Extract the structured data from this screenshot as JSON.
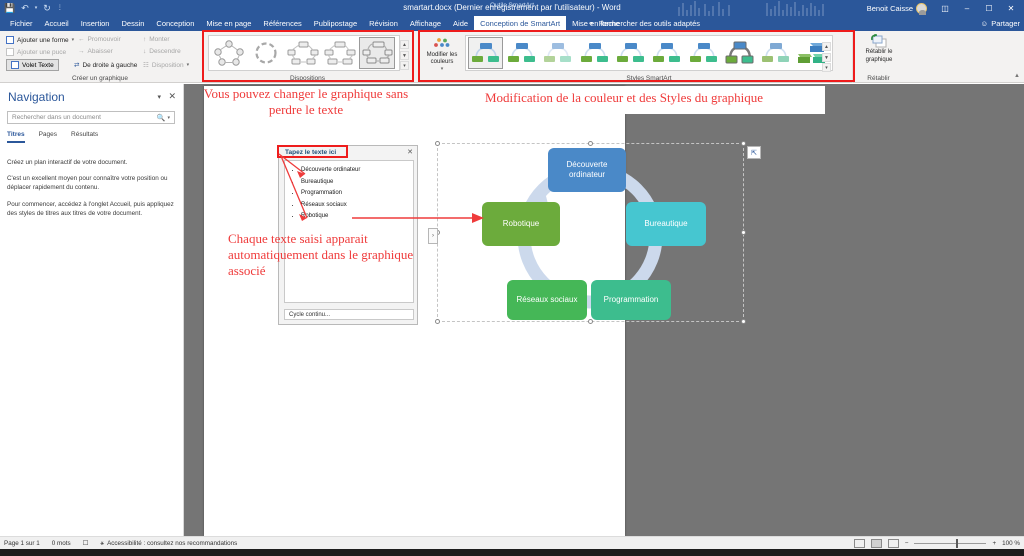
{
  "titlebar": {
    "doc_title": "smartart.docx (Dernier enregistrement par l'utilisateur)  -  Word",
    "contextual_label": "Outils SmartArt",
    "user_name": "Benoit Caisse",
    "qat": {
      "save_icon": "save-icon",
      "undo_icon": "undo-icon",
      "redo_icon": "redo-icon",
      "more_icon": "more-icon"
    },
    "window_buttons": {
      "ribbon_display": "ribbon-display-options-icon",
      "minimize": "–",
      "restore": "❐",
      "close": "✕"
    }
  },
  "tabs": [
    {
      "label": "Fichier",
      "state": "normal"
    },
    {
      "label": "Accueil",
      "state": "normal"
    },
    {
      "label": "Insertion",
      "state": "normal"
    },
    {
      "label": "Dessin",
      "state": "normal"
    },
    {
      "label": "Conception",
      "state": "normal"
    },
    {
      "label": "Mise en page",
      "state": "normal"
    },
    {
      "label": "Références",
      "state": "normal"
    },
    {
      "label": "Publipostage",
      "state": "normal"
    },
    {
      "label": "Révision",
      "state": "normal"
    },
    {
      "label": "Affichage",
      "state": "normal"
    },
    {
      "label": "Aide",
      "state": "normal"
    },
    {
      "label": "Conception de SmartArt",
      "state": "active"
    },
    {
      "label": "Mise en forme",
      "state": "contextual"
    }
  ],
  "search": {
    "label": "Rechercher des outils adaptés",
    "icon": "lightbulb-icon"
  },
  "share": {
    "label": "Partager",
    "icon": "share-person-icon"
  },
  "ribbon": {
    "group_create": {
      "name": "Créer un graphique",
      "commands": [
        {
          "label": "Ajouter une forme",
          "enabled": true,
          "has_caret": true
        },
        {
          "label": "Ajouter une puce",
          "enabled": false,
          "has_caret": false
        },
        {
          "label": "Volet Texte",
          "enabled": true,
          "has_caret": false
        },
        {
          "label": "Promouvoir",
          "enabled": false,
          "has_caret": false
        },
        {
          "label": "Abaisser",
          "enabled": false,
          "has_caret": false
        },
        {
          "label": "De droite à gauche",
          "enabled": true,
          "has_caret": false
        },
        {
          "label": "Monter",
          "enabled": false,
          "has_caret": false
        },
        {
          "label": "Descendre",
          "enabled": false,
          "has_caret": false
        },
        {
          "label": "Disposition",
          "enabled": false,
          "has_caret": true
        }
      ]
    },
    "group_layouts": {
      "name": "Dispositions",
      "selected_index": 4,
      "thumb_count": 5,
      "scroll_up": "▲",
      "scroll_down": "▼",
      "more": "▾"
    },
    "group_styles": {
      "name": "Styles SmartArt",
      "change_colors_label": "Modifier les couleurs",
      "change_colors_icon": "color-palette-icon",
      "selected_index": 0,
      "thumb_count": 10,
      "scroll_up": "▲",
      "scroll_down": "▼",
      "more": "▾"
    },
    "group_reset": {
      "name": "Rétablir",
      "button_label": "Rétablir le graphique",
      "icon": "reset-graphic-icon"
    },
    "collapse_icon": "chevron-up-icon"
  },
  "navigation": {
    "title": "Navigation",
    "chevron_icon": "chevron-down-icon",
    "close_icon": "close-icon",
    "search_placeholder": "Rechercher dans un document",
    "search_icon": "search-icon",
    "tabs": [
      {
        "label": "Titres",
        "active": true
      },
      {
        "label": "Pages",
        "active": false
      },
      {
        "label": "Résultats",
        "active": false
      }
    ],
    "paragraphs": [
      "Créez un plan interactif de votre document.",
      "C'est un excellent moyen pour connaître votre position ou déplacer rapidement du contenu.",
      "Pour commencer, accédez à l'onglet Accueil, puis appliquez des styles de titres aux titres de votre document."
    ]
  },
  "text_pane": {
    "title": "Tapez le texte ici",
    "close_icon": "close-icon",
    "items": [
      "Découverte ordinateur",
      "Bureautique",
      "Programmation",
      "Réseaux sociaux",
      "Robotique"
    ],
    "footer": "Cycle continu...",
    "toggle_icon": "chevron-right-icon"
  },
  "smartart": {
    "layout_options_icon": "layout-options-icon",
    "nodes": [
      {
        "label": "Découverte ordinateur",
        "color": "#4a89c8"
      },
      {
        "label": "Bureautique",
        "color": "#46c6d0"
      },
      {
        "label": "Programmation",
        "color": "#3dbd8e"
      },
      {
        "label": "Réseaux sociaux",
        "color": "#45b757"
      },
      {
        "label": "Robotique",
        "color": "#6cab3c"
      }
    ],
    "ring_color": "#ccd9ec"
  },
  "annotations": [
    {
      "id": "anno-layouts",
      "text": "Vous pouvez changer le graphique sans perdre le texte"
    },
    {
      "id": "anno-styles",
      "text": "Modification de la couleur et des Styles du graphique"
    },
    {
      "id": "anno-textpane",
      "text": "Chaque texte saisi apparait automatiquement dans le graphique associé"
    }
  ],
  "statusbar": {
    "page": "Page 1 sur 1",
    "words": "0 mots",
    "proofing_icon": "proofing-icon",
    "accessibility_icon": "accessibility-icon",
    "accessibility": "Accessibilité : consultez nos recommandations",
    "view_read_icon": "read-mode-icon",
    "view_print_icon": "print-layout-icon",
    "view_web_icon": "web-layout-icon",
    "zoom_out": "−",
    "zoom_in": "+",
    "zoom_level": "100 %"
  }
}
